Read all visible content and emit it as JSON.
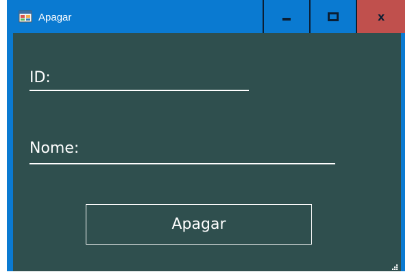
{
  "window": {
    "title": "Apagar",
    "icon": "app-window-icon",
    "controls": {
      "minimize_icon": "minimize-icon",
      "maximize_icon": "maximize-icon",
      "close_label": "x"
    }
  },
  "form": {
    "id_label": "ID:",
    "nome_label": "Nome:",
    "submit_label": "Apagar"
  },
  "colors": {
    "titlebar": "#0a7ad1",
    "client_background": "#2f4f4e",
    "close_button": "#c0504d",
    "text": "#ffffff"
  }
}
